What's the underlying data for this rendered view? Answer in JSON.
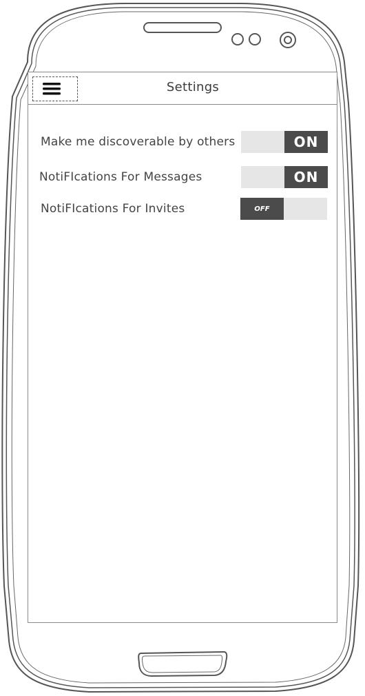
{
  "header": {
    "title": "Settings",
    "menu_icon": "hamburger-menu-icon"
  },
  "settings": [
    {
      "label": "Make me discoverable by others",
      "state": "ON"
    },
    {
      "label": "NotiFIcations For Messages",
      "state": "ON"
    },
    {
      "label": "NotiFIcations For Invites",
      "state": "OFF"
    }
  ],
  "colors": {
    "toggle_knob": "#4b4b4b",
    "toggle_track": "#e6e6e6",
    "frame_stroke": "#555555"
  }
}
